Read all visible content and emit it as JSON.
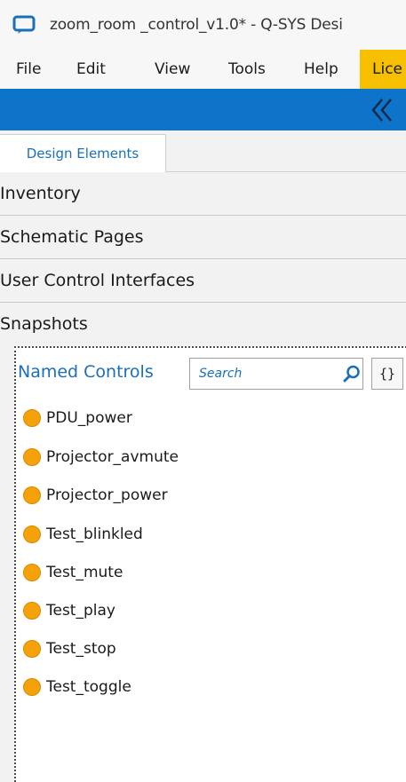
{
  "window": {
    "title": "zoom_room _control_v1.0* - Q-SYS Desi",
    "icon": "qsys-app-icon"
  },
  "menu": {
    "items": [
      "File",
      "Edit",
      "View",
      "Tools",
      "Help",
      "Lice"
    ]
  },
  "toolbar": {
    "collapse_icon": "double-chevron-left-icon",
    "accent_color": "#0d74c9"
  },
  "tabs": {
    "design_elements": "Design Elements"
  },
  "sections": {
    "inventory": "Inventory",
    "schematic_pages": "Schematic Pages",
    "user_control_interfaces": "User Control Interfaces",
    "snapshots": "Snapshots"
  },
  "named_controls": {
    "title": "Named Controls",
    "search_placeholder": "Search",
    "braces_label": "{}",
    "status_color": "#f5a20a",
    "items": [
      "PDU_power",
      "Projector_avmute",
      "Projector_power",
      "Test_blinkled",
      "Test_mute",
      "Test_play",
      "Test_stop",
      "Test_toggle"
    ]
  }
}
